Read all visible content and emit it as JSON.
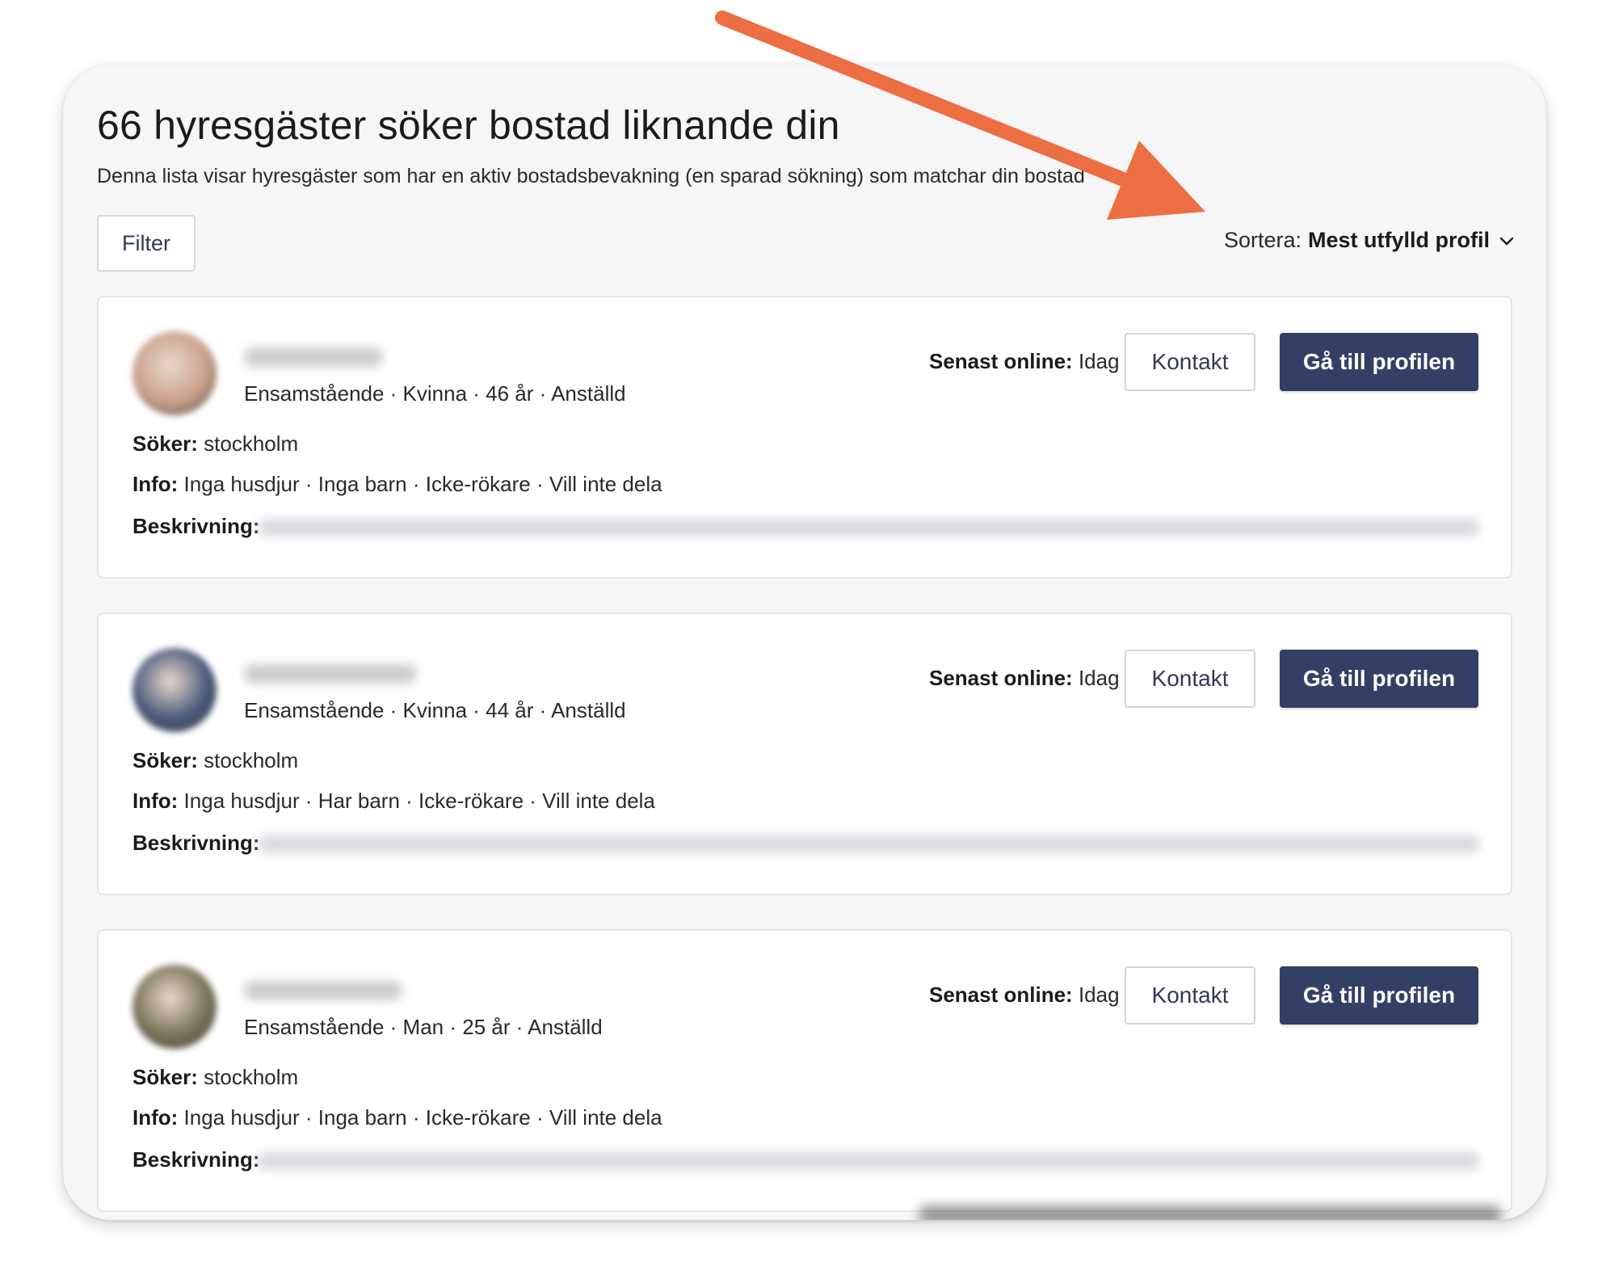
{
  "header": {
    "title": "66 hyresgäster söker bostad liknande din",
    "subtitle": "Denna lista visar hyresgäster som har en aktiv bostadsbevakning (en sparad sökning) som matchar din bostad"
  },
  "toolbar": {
    "filter_label": "Filter",
    "sort_prefix": "Sortera:",
    "sort_value": "Mest utfylld profil",
    "sort_icon": "chevron-down-icon"
  },
  "labels": {
    "online": "Senast online:",
    "soker": "Söker:",
    "info": "Info:",
    "beskrivning": "Beskrivning:",
    "kontakt": "Kontakt",
    "profile": "Gå till profilen"
  },
  "tenants": [
    {
      "meta": "Ensamstående · Kvinna · 46 år · Anställd",
      "online": "Idag",
      "soker": "stockholm",
      "info": "Inga husdjur · Inga barn · Icke-rökare · Vill inte dela",
      "avatar_color": "#c9a08a"
    },
    {
      "meta": "Ensamstående · Kvinna · 44 år · Anställd",
      "online": "Idag",
      "soker": "stockholm",
      "info": "Inga husdjur · Har barn · Icke-rökare · Vill inte dela",
      "avatar_color": "#4a5a7a"
    },
    {
      "meta": "Ensamstående · Man · 25 år · Anställd",
      "online": "Idag",
      "soker": "stockholm",
      "info": "Inga husdjur · Inga barn · Icke-rökare · Vill inte dela",
      "avatar_color": "#7a7258"
    }
  ],
  "colors": {
    "accent_button": "#343f66",
    "arrow": "#ee6e43"
  }
}
